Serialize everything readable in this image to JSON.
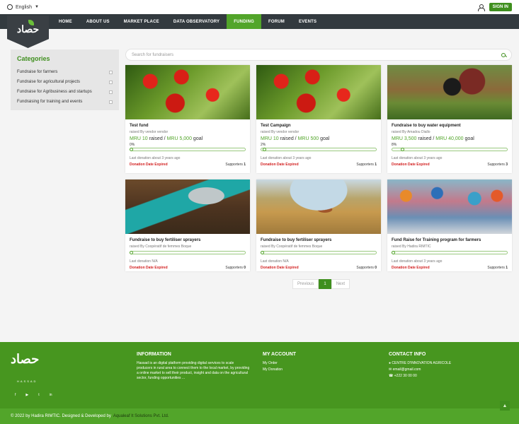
{
  "topbar": {
    "language": "English",
    "signin_label": "SIGN IN"
  },
  "nav": {
    "items": [
      "HOME",
      "ABOUT US",
      "MARKET PLACE",
      "DATA OBSERVATORY",
      "FUNDING",
      "FORUM",
      "EVENTS"
    ],
    "active": "FUNDING"
  },
  "logo": {
    "text": "حصاد"
  },
  "sidebar": {
    "title": "Categories",
    "categories": [
      "Fundraise for farmers",
      "Fundraise for agricultural projects",
      "Fundraise for Agribusiness and startups",
      "Fundraising for training and events"
    ]
  },
  "search": {
    "placeholder": "Search for fundraisers"
  },
  "cards": [
    {
      "image": "tomato",
      "title": "Test fund",
      "by": "raised By vendor vendor",
      "raised": "MRU 10",
      "goal": "MRU 5,000",
      "percent": "0%",
      "progress": 0,
      "last": "Last donation about 3 years ago",
      "status": "Donation Date Expired",
      "supporters_label": "Supporters",
      "supporters": "1"
    },
    {
      "image": "tomato",
      "title": "Test Campaign",
      "by": "raised By vendor vendor",
      "raised": "MRU 10",
      "goal": "MRU 500",
      "percent": "2%",
      "progress": 0.02,
      "last": "Last donation about 3 years ago",
      "status": "Donation Date Expired",
      "supporters_label": "Supporters",
      "supporters": "1"
    },
    {
      "image": "farmer",
      "title": "Fundraise to buy water equipment",
      "by": "raised By Amadou Diallo",
      "raised": "MRU 3,500",
      "goal": "MRU 40,000",
      "percent": "8%",
      "progress": 0.08,
      "last": "Last donation about 3 years ago",
      "status": "Donation Date Expired",
      "supporters_label": "Supporters",
      "supporters": "3"
    },
    {
      "image": "shovel",
      "title": "Fundraise to buy fertiliser sprayers",
      "by": "raised By Coopératif de femmes Boque",
      "last": "Last donation N/A",
      "status": "Donation Date Expired",
      "supporters_label": "Supporters",
      "supporters": "0"
    },
    {
      "image": "field",
      "title": "Fundraise to buy fertiliser sprayers",
      "by": "raised By Coopératif de femmes Boque",
      "last": "Last donation N/A",
      "status": "Donation Date Expired",
      "supporters_label": "Supporters",
      "supporters": "0"
    },
    {
      "image": "people",
      "title": "Fund Raise for Training program for farmers",
      "by": "raised By Hadira RIMTIC",
      "last": "Last donation about 3 years ago",
      "status": "Donation Date Expired",
      "supporters_label": "Supporters",
      "supporters": "1"
    }
  ],
  "card_labels": {
    "raised_word": "raised",
    "goal_word": "goal"
  },
  "pager": {
    "prev": "Previous",
    "current": "1",
    "next": "Next"
  },
  "footer": {
    "logo_sub": "HASSAD",
    "info_title": "INFORMATION",
    "info_text": "Hassad is an digital platform providing digital services to scale producers in rural area to connect them to the local market, by providing a online market to sell their product, insight and data on the agricultural sector, funding opportunities ...",
    "account_title": "MY ACCOUNT",
    "account_links": [
      "My Order",
      "My Donation"
    ],
    "contact_title": "CONTACT INFO",
    "contact": [
      "CENTRE D'INNOVATION AGRICOLE",
      "email@gmail.com",
      "+222 30 00 00"
    ],
    "social_icons": [
      "facebook-icon",
      "youtube-icon",
      "twitter-icon",
      "linkedin-icon"
    ]
  },
  "copyright": {
    "text": "© 2022 by Hadira RIMTIC. Designed & Developed by",
    "developer": "Aqualeaf It Solutions Pvt. Ltd."
  }
}
